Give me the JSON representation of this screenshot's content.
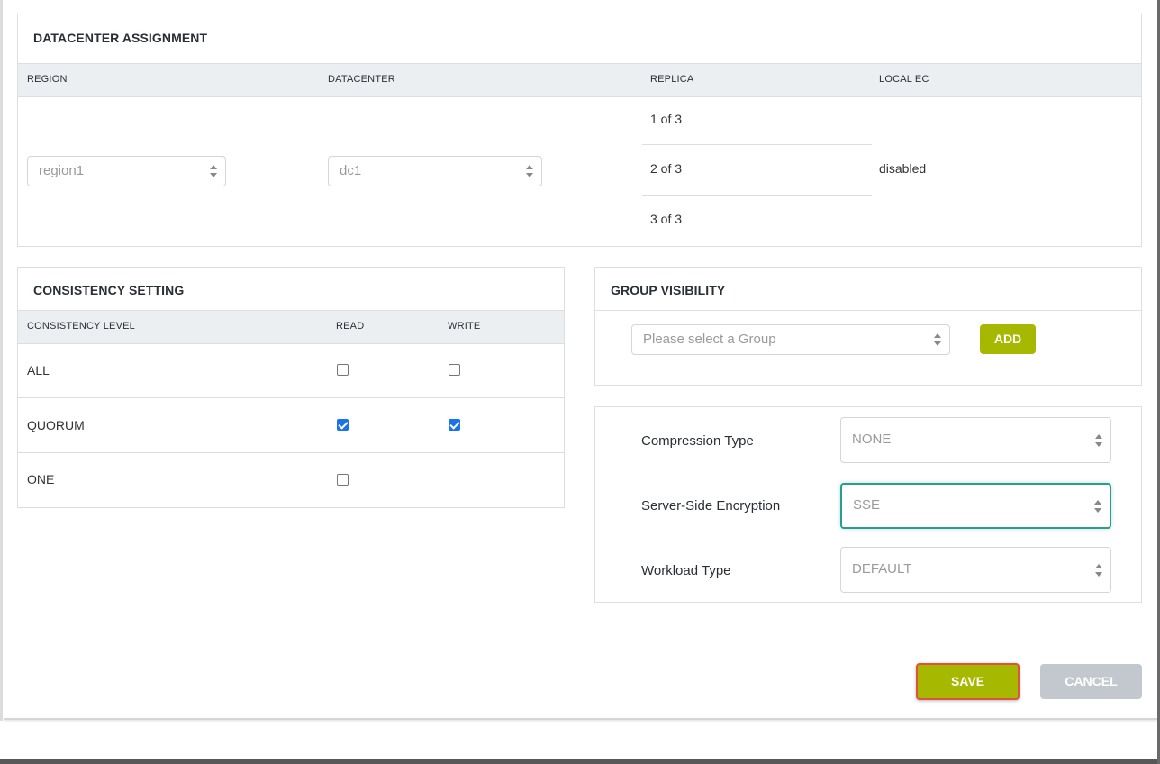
{
  "datacenter": {
    "title": "DATACENTER ASSIGNMENT",
    "columns": [
      "REGION",
      "DATACENTER",
      "REPLICA",
      "LOCAL EC"
    ],
    "region_value": "region1",
    "datacenter_value": "dc1",
    "replicas": [
      "1 of 3",
      "2 of 3",
      "3 of 3"
    ],
    "local_ec": "disabled"
  },
  "consistency": {
    "title": "CONSISTENCY SETTING",
    "columns": [
      "CONSISTENCY LEVEL",
      "READ",
      "WRITE"
    ],
    "rows": [
      {
        "level": "ALL",
        "read": false,
        "write": false
      },
      {
        "level": "QUORUM",
        "read": true,
        "write": true
      },
      {
        "level": "ONE",
        "read": false,
        "write": null
      }
    ]
  },
  "group_visibility": {
    "title": "GROUP VISIBILITY",
    "placeholder": "Please select a Group",
    "add_label": "ADD"
  },
  "settings": {
    "compression_label": "Compression Type",
    "compression_value": "NONE",
    "encryption_label": "Server-Side Encryption",
    "encryption_value": "SSE",
    "workload_label": "Workload Type",
    "workload_value": "DEFAULT"
  },
  "actions": {
    "save_label": "SAVE",
    "cancel_label": "CANCEL"
  },
  "colors": {
    "accent_green": "#a6b800",
    "focus_teal": "#2a9d8f",
    "save_outline": "#e0523a",
    "cancel_gray": "#c3c8ce",
    "checkbox_blue": "#1a73e8"
  }
}
